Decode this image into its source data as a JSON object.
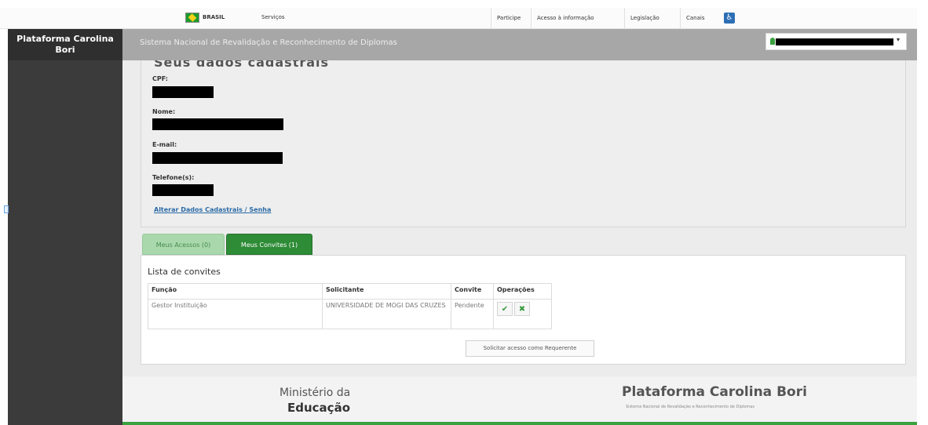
{
  "govbar": {
    "brasil": "BRASIL",
    "servicos": "Serviços",
    "links": [
      "Participe",
      "Acesso à informação",
      "Legislação",
      "Canais"
    ]
  },
  "sidebar": {
    "brand": "Plataforma Carolina Bori"
  },
  "header": {
    "system_name": "Sistema Nacional de Revalidação e Reconhecimento de Diplomas"
  },
  "profile": {
    "section_title": "Seus dados cadastrais",
    "cpf_label": "CPF:",
    "nome_label": "Nome:",
    "email_label": "E-mail:",
    "telefone_label": "Telefone(s):",
    "alter_link": "Alterar Dados Cadastrais / Senha"
  },
  "tabs": {
    "acessos": "Meus Acessos (0)",
    "convites": "Meus Convites (1)"
  },
  "invites": {
    "title": "Lista de convites",
    "columns": [
      "Função",
      "Solicitante",
      "Convite",
      "Operações"
    ],
    "rows": [
      {
        "funcao": "Gestor Instituição",
        "solicitante": "UNIVERSIDADE DE MOGI DAS CRUZES",
        "convite": "Pendente"
      }
    ],
    "accept_glyph": "✔",
    "reject_glyph": "✖"
  },
  "request_button": "Solicitar acesso como Requerente",
  "footer": {
    "ministerio_line1": "Ministério da",
    "ministerio_line2": "Educação",
    "platform_title": "Plataforma Carolina Bori",
    "platform_subtitle": "Sistema Nacional de Revalidação e Reconhecimento de Diplomas"
  },
  "colors": {
    "accent_green": "#2e8b36",
    "tab_light_green": "#a8d8ac",
    "sidebar": "#3b3b3b"
  }
}
